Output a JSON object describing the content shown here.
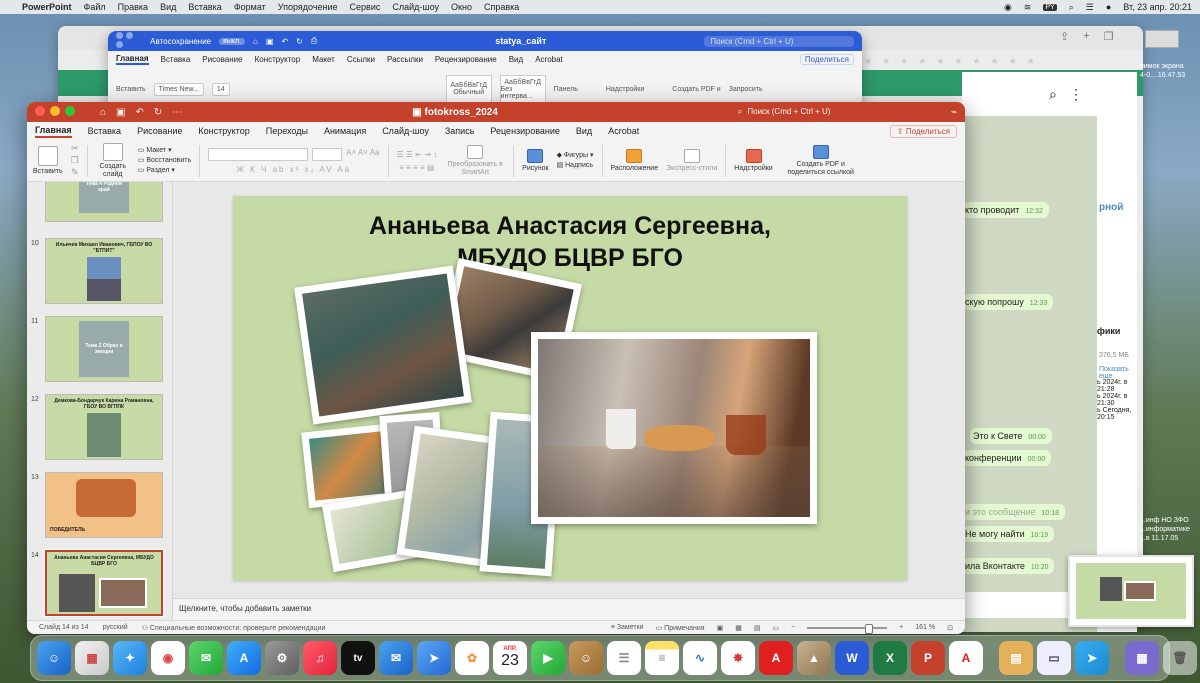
{
  "menubar": {
    "app": "PowerPoint",
    "items": [
      "Файл",
      "Правка",
      "Вид",
      "Вставка",
      "Формат",
      "Упорядочение",
      "Сервис",
      "Слайд-шоу",
      "Окно",
      "Справка"
    ],
    "input_lang": "PY",
    "datetime": "Вт, 23 апр.  20:21"
  },
  "word": {
    "autosave": "Автосохранение",
    "autosave_state": "выкл.",
    "doc_title": "statya_сайт",
    "search_placeholder": "Поиск (Cmd + Ctrl + U)",
    "tabs": [
      "Главная",
      "Вставка",
      "Рисование",
      "Конструктор",
      "Макет",
      "Ссылки",
      "Рассылки",
      "Рецензирование",
      "Вид",
      "Acrobat"
    ],
    "share": "Поделиться",
    "font": "Times New...",
    "size": "14",
    "paste": "Вставить",
    "style1": "АаБбВвГгД",
    "style1_name": "Обычный",
    "style2": "АаБбВвГгД",
    "style2_name": "Без интерва...",
    "panel": "Панель",
    "addins": "Надстройки",
    "pdf": "Создать PDF и",
    "request": "Запросить"
  },
  "chat": {
    "m1": "кто проводит",
    "m1_time": "12:32",
    "m2": "скую попрошу",
    "m2_time": "12:33",
    "m3": "Это к Свете",
    "m3_time": "00:00",
    "m4": "конференции",
    "m4_time": "00:00",
    "m5": "и это сообщение",
    "m5_time": "10:18",
    "m6": "Не могу найти",
    "m6_time": "10:19",
    "m7": "ила Вконтакте",
    "m7_time": "10:20",
    "info_title": "фики",
    "size": "376,5 МБ",
    "show_more": "Показать еще",
    "d1": "ь 2024г. в 21:28",
    "d2": "ь 2024г. в 21:30",
    "d3": "ь Сегодня, 20:15",
    "blue_word": "рной",
    "files1": "...инф НО ЗФО",
    "files2": "...информатике",
    "files3": "...в 11.17.05",
    "screenshot1": "нимок экрана",
    "screenshot2": "4-0....16.47.53"
  },
  "ppt": {
    "doc_title": "fotokross_2024",
    "search_placeholder": "Поиск (Cmd + Ctrl + U)",
    "tabs": [
      "Главная",
      "Вставка",
      "Рисование",
      "Конструктор",
      "Переходы",
      "Анимация",
      "Слайд-шоу",
      "Запись",
      "Рецензирование",
      "Вид",
      "Acrobat"
    ],
    "share": "Поделиться",
    "ribbon": {
      "paste": "Вставить",
      "new_slide": "Создать слайд",
      "layout": "Макет",
      "reset": "Восстановить",
      "section": "Раздел",
      "smartart": "Преобразовать в SmartArt",
      "picture": "Рисунок",
      "shapes": "Фигуры",
      "textbox": "Надпись",
      "arrange": "Расположение",
      "quick_styles": "Экспресс-стили",
      "addins": "Надстройки",
      "pdf": "Создать PDF и поделиться ссылкой"
    },
    "thumbnails": [
      {
        "num": "",
        "title": "Тема 4 Родной край"
      },
      {
        "num": "10",
        "title": "Ильичев Михаил Иванович, ГБПОУ ВО \"БТПИТ\""
      },
      {
        "num": "11",
        "title": "Тема 2 Образ и эмоции"
      },
      {
        "num": "12",
        "title": "Демкова-Бондарчук Карина Романовна, ГБОУ ВО ВГППК"
      },
      {
        "num": "13",
        "title": "ПОБЕДИТЕЛЬ"
      },
      {
        "num": "14",
        "title": "Ананьева Анастасия Сергеевна, МБУДО БЦВР БГО"
      }
    ],
    "slide_title_line1": "Ананьева Анастасия Сергеевна,",
    "slide_title_line2": "МБУДО БЦВР БГО",
    "notes_placeholder": "Щелкните, чтобы добавить заметки",
    "status": {
      "slide": "Слайд 14 из 14",
      "lang": "русский",
      "accessibility": "Специальные возможности: проверьте рекомендации",
      "notes": "Заметки",
      "comments": "Примечания",
      "zoom": "161 %"
    }
  },
  "dock": {
    "calendar_month": "АПР.",
    "calendar_day": "23",
    "apple_tv": "tv"
  }
}
